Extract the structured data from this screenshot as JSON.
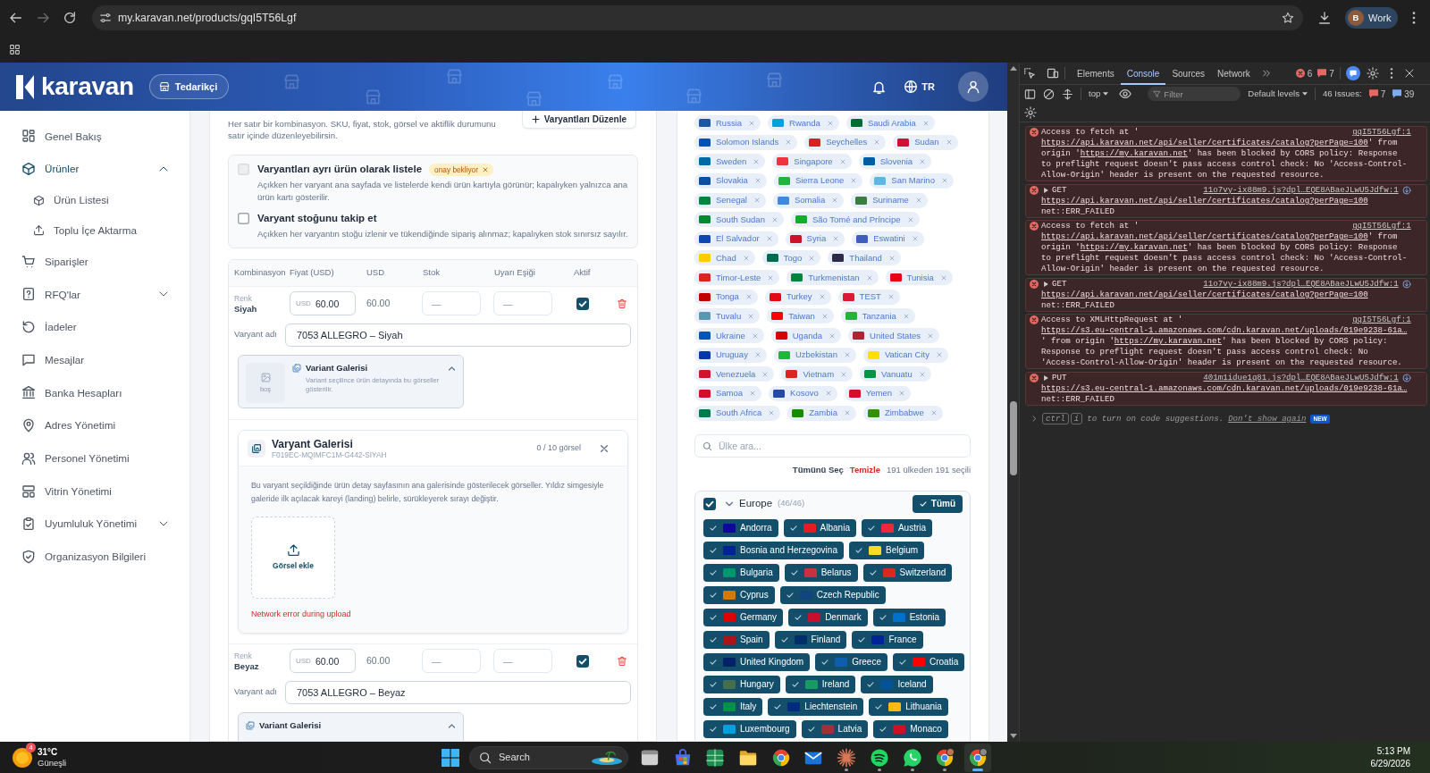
{
  "browser": {
    "url": "my.karavan.net/products/gqI5T56Lgf",
    "profile_initial": "B",
    "profile_name": "Work"
  },
  "header": {
    "logo_text": "karavan",
    "role": "Tedarikçi",
    "language": "TR"
  },
  "sidebar": {
    "items": [
      {
        "label": "Genel Bakış",
        "selected": false
      },
      {
        "label": "Ürünler",
        "selected": true,
        "expanded": true,
        "children": [
          {
            "label": "Ürün Listesi",
            "selected": false
          },
          {
            "label": "Toplu İçe Aktarma",
            "selected": false
          }
        ]
      },
      {
        "label": "Siparişler",
        "selected": false
      },
      {
        "label": "RFQ'lar",
        "selected": false,
        "expanded": false
      },
      {
        "label": "İadeler",
        "selected": false
      },
      {
        "label": "Mesajlar",
        "selected": false
      },
      {
        "label": "Banka Hesapları",
        "selected": false
      },
      {
        "label": "Adres Yönetimi",
        "selected": false
      },
      {
        "label": "Personel Yönetimi",
        "selected": false
      },
      {
        "label": "Vitrin Yönetimi",
        "selected": false
      },
      {
        "label": "Uyumluluk Yönetimi",
        "selected": false,
        "expanded": false
      },
      {
        "label": "Organizasyon Bilgileri",
        "selected": false
      }
    ]
  },
  "variants": {
    "description": "Her satır bir kombinasyon. SKU, fiyat, stok, görsel ve aktiflik durumunu satır içinde düzenleyebilirsin.",
    "edit_button": "Varyantları Düzenle",
    "options": [
      {
        "label": "Varyantları ayrı ürün olarak listele",
        "checked": false,
        "disabled": true,
        "badge": "onay bekliyor",
        "description": "Açıkken her varyant ana sayfada ve listelerde kendi ürün kartıyla görünür; kapalıyken yalnızca ana ürün kartı gösterilir."
      },
      {
        "label": "Varyant stoğunu takip et",
        "checked": false,
        "disabled": false,
        "description": "Açıkken her varyantın stoğu izlenir ve tükendiğinde sipariş alınmaz; kapalıyken stok sınırsız sayılır."
      }
    ],
    "table": {
      "columns": [
        "Kombinasyon",
        "Fiyat (USD)",
        "USD",
        "Stok",
        "Uyarı Eşiği",
        "Aktif"
      ],
      "rows": [
        {
          "attribute": "Renk",
          "value": "Siyah",
          "currency": "USD",
          "price": "60.00",
          "usd_price": "60.00",
          "stock_placeholder": "—",
          "threshold_placeholder": "—",
          "active": true,
          "name_label": "Varyant adı",
          "name": "7053 ALLEGRO – Siyah",
          "gallery_preview": {
            "title": "Variant Galerisi",
            "description": "Variant seçilince ürün detayında bu görseller gösterilir.",
            "thumbnail_label": "boş"
          },
          "gallery_editor": {
            "title": "Varyant Galerisi",
            "sku": "F019EC-MQIMFC1M-G442-SIYAH",
            "count": "0 / 10 görsel",
            "description": "Bu varyant seçildiğinde ürün detay sayfasının ana galerisinde gösterilecek görseller. Yıldız simgesiyle galeride ilk açılacak kareyi (landing) belirle, sürükleyerek sırayı değiştir.",
            "upload_label": "Görsel ekle",
            "error": "Network error during upload"
          }
        },
        {
          "attribute": "Renk",
          "value": "Beyaz",
          "currency": "USD",
          "price": "60.00",
          "usd_price": "60.00",
          "stock_placeholder": "—",
          "threshold_placeholder": "—",
          "active": true,
          "name_label": "Varyant adı",
          "name": "7053 ALLEGRO – Beyaz",
          "gallery_preview": {
            "title": "Variant Galerisi"
          }
        }
      ]
    }
  },
  "countries": {
    "selected_rows": [
      [
        {
          "name": "Russia",
          "color": "#1c57a7"
        },
        {
          "name": "Rwanda",
          "color": "#00a1de"
        },
        {
          "name": "Saudi Arabia",
          "color": "#006c35"
        }
      ],
      [
        {
          "name": "Solomon Islands",
          "color": "#0051ba"
        },
        {
          "name": "Seychelles",
          "color": "#d92223"
        },
        {
          "name": "Sudan",
          "color": "#d21034"
        }
      ],
      [
        {
          "name": "Sweden",
          "color": "#006aa7"
        },
        {
          "name": "Singapore",
          "color": "#ef3340"
        },
        {
          "name": "Slovenia",
          "color": "#005da4"
        }
      ],
      [
        {
          "name": "Slovakia",
          "color": "#0b4ea2"
        },
        {
          "name": "Sierra Leone",
          "color": "#1eb53a"
        },
        {
          "name": "San Marino",
          "color": "#5eb6e4"
        }
      ],
      [
        {
          "name": "Senegal",
          "color": "#00853f"
        },
        {
          "name": "Somalia",
          "color": "#4189dd"
        },
        {
          "name": "Suriname",
          "color": "#377e3f"
        }
      ],
      [
        {
          "name": "South Sudan",
          "color": "#078930"
        },
        {
          "name": "São Tomé and Príncipe",
          "color": "#12ad2b"
        }
      ],
      [
        {
          "name": "El Salvador",
          "color": "#0f47af"
        },
        {
          "name": "Syria",
          "color": "#ce1126"
        },
        {
          "name": "Eswatini",
          "color": "#3e5eb9"
        }
      ],
      [
        {
          "name": "Chad",
          "color": "#fecb00"
        },
        {
          "name": "Togo",
          "color": "#006a4e"
        },
        {
          "name": "Thailand",
          "color": "#2d2a4a"
        }
      ],
      [
        {
          "name": "Timor-Leste",
          "color": "#dc241f"
        },
        {
          "name": "Turkmenistan",
          "color": "#00843d"
        },
        {
          "name": "Tunisia",
          "color": "#e70013"
        }
      ],
      [
        {
          "name": "Tonga",
          "color": "#c10000"
        },
        {
          "name": "Turkey",
          "color": "#e30a17"
        },
        {
          "name": "TEST",
          "color": "#da1a35"
        }
      ],
      [
        {
          "name": "Tuvalu",
          "color": "#5b97b1"
        },
        {
          "name": "Taiwan",
          "color": "#fe0000"
        },
        {
          "name": "Tanzania",
          "color": "#1eb53a"
        }
      ],
      [
        {
          "name": "Ukraine",
          "color": "#0057b7"
        },
        {
          "name": "Uganda",
          "color": "#d90000"
        },
        {
          "name": "United States",
          "color": "#b22234"
        }
      ],
      [
        {
          "name": "Uruguay",
          "color": "#0038a8"
        },
        {
          "name": "Uzbekistan",
          "color": "#1eb53a"
        },
        {
          "name": "Vatican City",
          "color": "#ffe000"
        }
      ],
      [
        {
          "name": "Venezuela",
          "color": "#cf142b"
        },
        {
          "name": "Vietnam",
          "color": "#da251d"
        },
        {
          "name": "Vanuatu",
          "color": "#009543"
        }
      ],
      [
        {
          "name": "Samoa",
          "color": "#ce1126"
        },
        {
          "name": "Kosovo",
          "color": "#244aa5"
        },
        {
          "name": "Yemen",
          "color": "#ce1126"
        }
      ],
      [
        {
          "name": "South Africa",
          "color": "#007a4d"
        },
        {
          "name": "Zambia",
          "color": "#198a00"
        },
        {
          "name": "Zimbabwe",
          "color": "#319208"
        }
      ]
    ],
    "search_placeholder": "Ülke ara...",
    "select_all": "Tümünü Seç",
    "clear": "Temizle",
    "summary": "191 ülkeden 191 seçili",
    "regions": [
      {
        "name": "Europe",
        "count": "(46/46)",
        "checked": true,
        "expanded": true,
        "all_button": "Tümü",
        "country_rows": [
          [
            {
              "name": "Andorra",
              "color": "#10069f",
              "selected": true
            },
            {
              "name": "Albania",
              "color": "#e41e20",
              "selected": true
            },
            {
              "name": "Austria",
              "color": "#ed2939",
              "selected": true
            }
          ],
          [
            {
              "name": "Bosnia and Herzegovina",
              "color": "#002395",
              "selected": true
            },
            {
              "name": "Belgium",
              "color": "#fdda24",
              "selected": true
            }
          ],
          [
            {
              "name": "Bulgaria",
              "color": "#00966e",
              "selected": true
            },
            {
              "name": "Belarus",
              "color": "#c8313e",
              "selected": true
            },
            {
              "name": "Switzerland",
              "color": "#da291c",
              "selected": true
            }
          ],
          [
            {
              "name": "Cyprus",
              "color": "#d57800",
              "selected": true
            },
            {
              "name": "Czech Republic",
              "color": "#11457e",
              "selected": true
            }
          ],
          [
            {
              "name": "Germany",
              "color": "#dd0000",
              "selected": true
            },
            {
              "name": "Denmark",
              "color": "#c8102e",
              "selected": true
            },
            {
              "name": "Estonia",
              "color": "#0072ce",
              "selected": true
            }
          ],
          [
            {
              "name": "Spain",
              "color": "#aa151b",
              "selected": true
            },
            {
              "name": "Finland",
              "color": "#002f6c",
              "selected": true
            },
            {
              "name": "France",
              "color": "#002395",
              "selected": true
            }
          ],
          [
            {
              "name": "United Kingdom",
              "color": "#012169",
              "selected": true
            },
            {
              "name": "Greece",
              "color": "#0d5eaf",
              "selected": true
            },
            {
              "name": "Croatia",
              "color": "#ff0000",
              "selected": true
            }
          ],
          [
            {
              "name": "Hungary",
              "color": "#436f4d",
              "selected": true
            },
            {
              "name": "Ireland",
              "color": "#169b62",
              "selected": true
            },
            {
              "name": "Iceland",
              "color": "#02529c",
              "selected": true
            }
          ],
          [
            {
              "name": "Italy",
              "color": "#009246",
              "selected": true
            },
            {
              "name": "Liechtenstein",
              "color": "#002b7f",
              "selected": true
            },
            {
              "name": "Lithuania",
              "color": "#fdb913",
              "selected": true
            }
          ],
          [
            {
              "name": "Luxembourg",
              "color": "#00a1de",
              "selected": true
            },
            {
              "name": "Latvia",
              "color": "#9e3039",
              "selected": true
            },
            {
              "name": "Monaco",
              "color": "#ce1126",
              "selected": true
            }
          ]
        ]
      }
    ]
  },
  "devtools": {
    "tabs": [
      {
        "label": "Elements",
        "selected": false
      },
      {
        "label": "Console",
        "selected": true
      },
      {
        "label": "Sources",
        "selected": false
      },
      {
        "label": "Network",
        "selected": false
      }
    ],
    "error_count": "6",
    "issue_count": "7",
    "context": "top",
    "filter_placeholder": "Filter",
    "levels": "Default levels",
    "issues_label": "46 Issues:",
    "issue_errors": "7",
    "issue_infos": "39",
    "messages": [
      {
        "kind": "cors",
        "source": "gqI5T56Lgf:1",
        "parts": [
          {
            "text": "Access to fetch at '"
          },
          {
            "link": "https://api.karavan.net/api/seller/certificates/catalog?perPage=100"
          },
          {
            "text": "' from origin '"
          },
          {
            "link": "https://my.karavan.net"
          },
          {
            "text": "' has been blocked by CORS policy: Response to preflight request doesn't pass access control check: No 'Access-Control-Allow-Origin' header is present on the requested resource."
          }
        ]
      },
      {
        "kind": "request",
        "method": "GET",
        "source": "11o7vy-ix88m9.js?dpl…EQE8ABaeJLwU5Jdfw:1",
        "url": "https://api.karavan.net/api/seller/certificates/catalog?perPage=100",
        "status": "net::ERR_FAILED"
      },
      {
        "kind": "cors",
        "source": "gqI5T56Lgf:1",
        "parts": [
          {
            "text": "Access to fetch at '"
          },
          {
            "link": "https://api.karavan.net/api/seller/certificates/catalog?perPage=100"
          },
          {
            "text": "' from origin '"
          },
          {
            "link": "https://my.karavan.net"
          },
          {
            "text": "' has been blocked by CORS policy: Response to preflight request doesn't pass access control check: No 'Access-Control-Allow-Origin' header is present on the requested resource."
          }
        ]
      },
      {
        "kind": "request",
        "method": "GET",
        "source": "11o7vy-ix88m9.js?dpl…EQE8ABaeJLwU5Jdfw:1",
        "url": "https://api.karavan.net/api/seller/certificates/catalog?perPage=100",
        "status": "net::ERR_FAILED"
      },
      {
        "kind": "cors",
        "source": "gqI5T56Lgf:1",
        "parts": [
          {
            "text": "Access to XMLHttpRequest at '"
          },
          {
            "link": "https://s3.eu-central-1.amazonaws.com/cdn.karavan.net/uploads/019e9238-61a…"
          },
          {
            "text": "' from origin '"
          },
          {
            "link": "https://my.karavan.net"
          },
          {
            "text": "' has been blocked by CORS policy: Response to preflight request doesn't pass access control check: No 'Access-Control-Allow-Origin' header is present on the requested resource."
          }
        ]
      },
      {
        "kind": "request",
        "method": "PUT",
        "source": "401m1idue1q81.js?dpl…EQE8ABaeJLwU5Jdfw:1",
        "url": "https://s3.eu-central-1.amazonaws.com/cdn.karavan.net/uploads/019e9238-61a…",
        "status": "net::ERR_FAILED"
      }
    ],
    "prompt": {
      "keys": [
        "ctrl",
        "i"
      ],
      "hint": "to turn on code suggestions.",
      "link": "Don't show again",
      "badge": "NEW"
    }
  },
  "taskbar": {
    "weather": {
      "badge": "4",
      "temperature": "31°C",
      "condition": "Güneşli"
    },
    "search_label": "Search",
    "apps": [
      {
        "running": false,
        "selected": false
      },
      {
        "running": false,
        "selected": false
      },
      {
        "running": false,
        "selected": false
      },
      {
        "running": false,
        "selected": false
      },
      {
        "running": false,
        "selected": false
      },
      {
        "running": false,
        "selected": false
      },
      {
        "running": true,
        "selected": false
      },
      {
        "running": true,
        "selected": false
      },
      {
        "running": true,
        "selected": false
      },
      {
        "running": true,
        "selected": false
      },
      {
        "running": true,
        "selected": true
      }
    ],
    "time": "5:13 PM",
    "date": "6/29/2026"
  }
}
